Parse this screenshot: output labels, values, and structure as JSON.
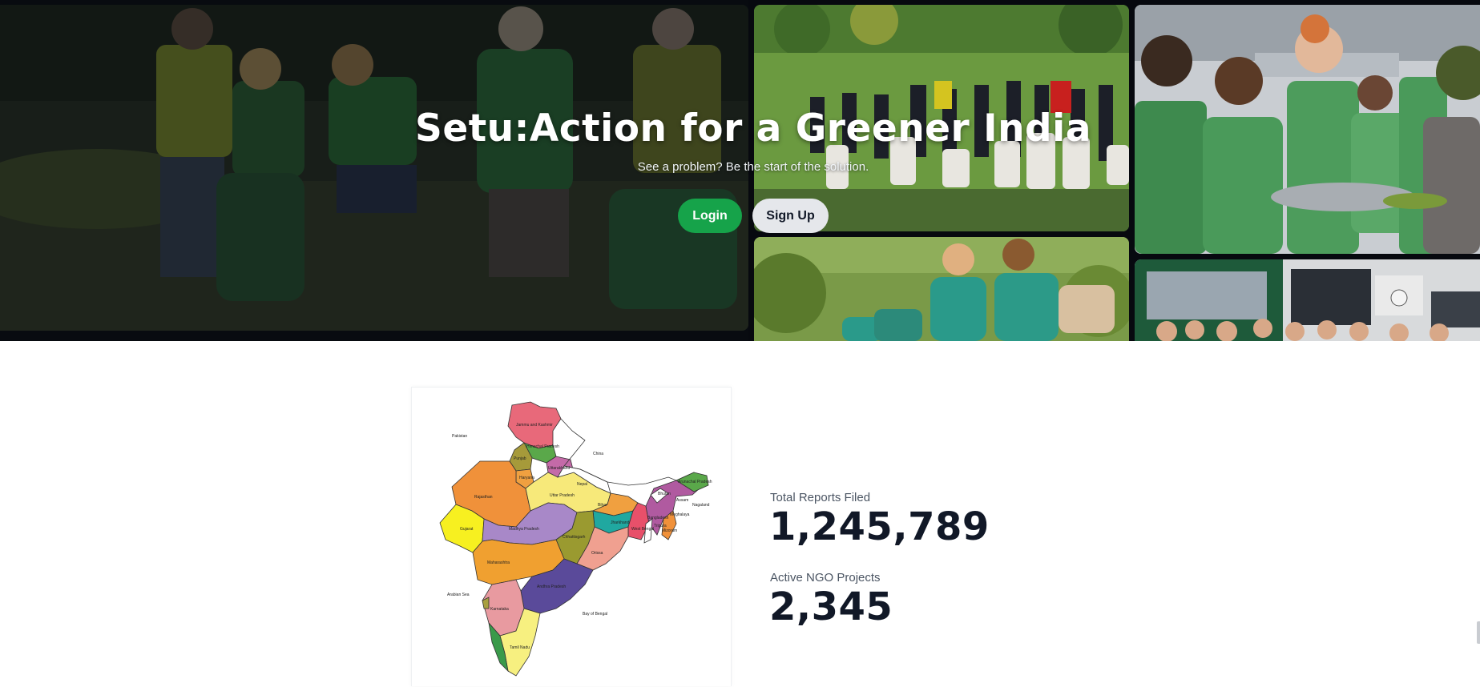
{
  "hero": {
    "title": "Setu:Action for a Greener India",
    "subtitle": "See a problem? Be the start of the solution.",
    "login_label": "Login",
    "signup_label": "Sign Up",
    "accent_color": "#16a34a"
  },
  "map": {
    "labels": {
      "jk": "Jammu and Kashmir",
      "pakistan": "Pakistan",
      "china": "China",
      "himachal": "Himachal Pradesh",
      "punjab": "Punjab",
      "uttarakhand": "Uttarakhand",
      "haryana": "Haryana",
      "nepal": "Nepal",
      "bhutan": "Bhutan",
      "arunachal": "Arunachal Pradesh",
      "rajasthan": "Rajasthan",
      "up": "Uttar Pradesh",
      "bihar": "Bihar",
      "assam": "Assam",
      "nagaland": "Nagaland",
      "bangladesh": "Bangladesh",
      "meghalaya": "Meghalaya",
      "gujarat": "Gujarat",
      "mp": "Madhya Pradesh",
      "jharkhand": "Jharkhand",
      "wb": "West Bengal",
      "tripura": "Tripura",
      "mizoram": "Mizoram",
      "chhattisgarh": "Chhattisgarh",
      "odisha": "Orissa",
      "maharashtra": "Maharashtra",
      "telangana": "Andhra Pradesh",
      "arabian": "Arabian Sea",
      "bay": "Bay of Bengal",
      "karnataka": "Karnataka",
      "tn": "Tamil Nadu"
    }
  },
  "stats": [
    {
      "label": "Total Reports Filed",
      "value": "1,245,789"
    },
    {
      "label": "Active NGO Projects",
      "value": "2,345"
    }
  ]
}
